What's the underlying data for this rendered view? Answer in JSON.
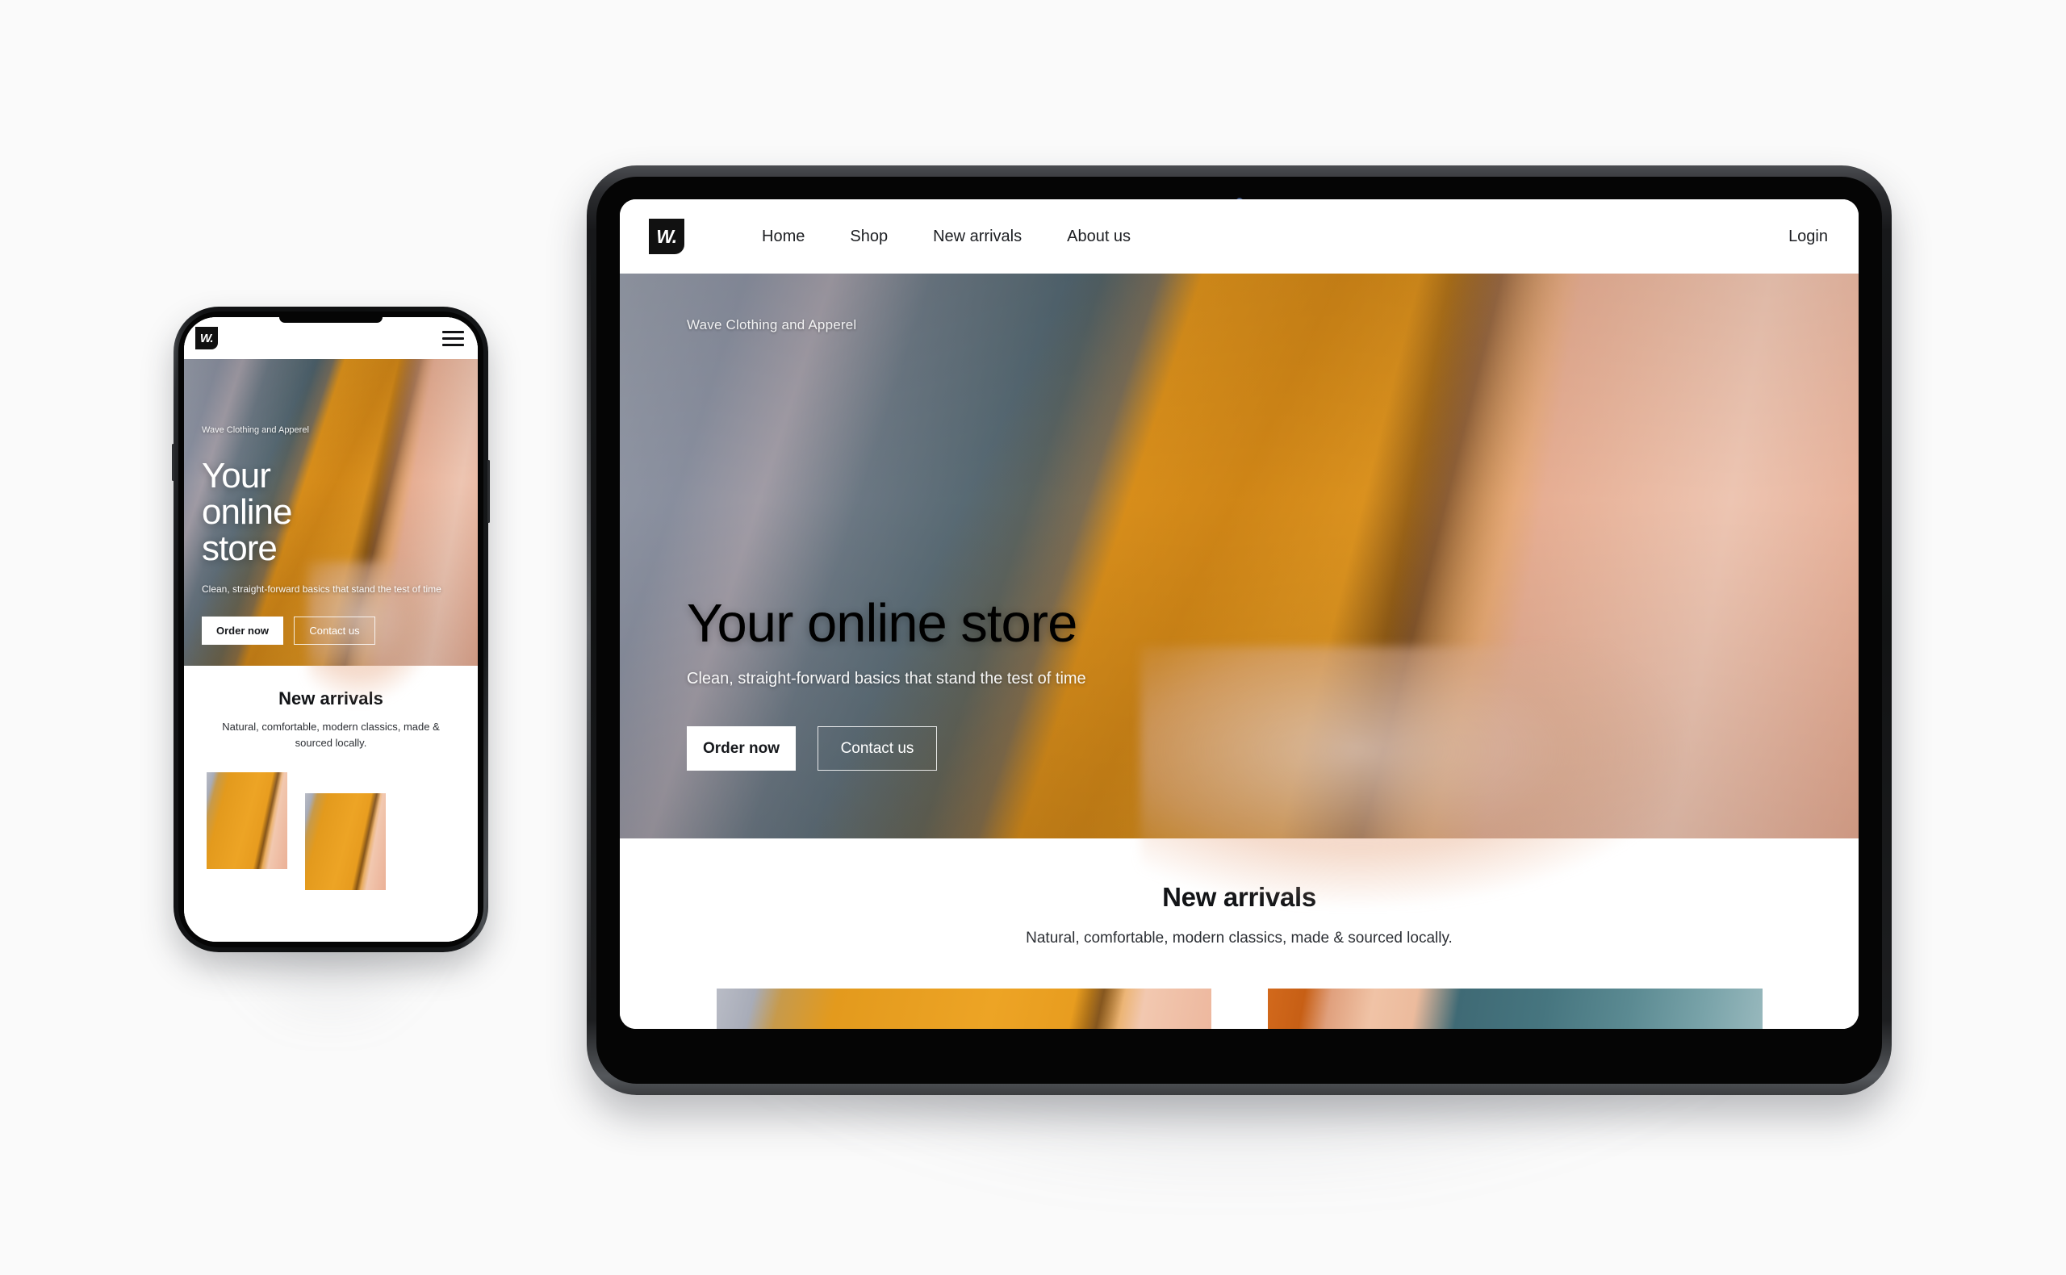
{
  "page": {
    "background_color": "#fafafa",
    "devices": [
      "tablet",
      "phone"
    ]
  },
  "brand": {
    "logo_text": "W.",
    "logo_bg": "#111111",
    "logo_fg": "#ffffff"
  },
  "site": {
    "nav": {
      "links": [
        {
          "label": "Home"
        },
        {
          "label": "Shop"
        },
        {
          "label": "New arrivals"
        },
        {
          "label": "About us"
        }
      ],
      "login_label": "Login",
      "menu_icon": "hamburger-menu-icon"
    },
    "hero": {
      "eyebrow": "Wave Clothing and Apperel",
      "heading": "Your online store",
      "heading_mobile_lines": [
        "Your",
        "online",
        "store"
      ],
      "subheading": "Clean, straight-forward basics that stand the test of time",
      "primary_button": "Order now",
      "secondary_button": "Contact us"
    },
    "arrivals": {
      "title": "New arrivals",
      "description": "Natural, comfortable, modern classics, made & sourced locally.",
      "cards": [
        {
          "alt": "amber-shirt-product-photo"
        },
        {
          "alt": "teal-denim-product-photo"
        }
      ]
    }
  },
  "colors": {
    "accent_amber": "#eda425",
    "accent_denim": "#5d6f79",
    "text_dark": "#121417",
    "surface": "#ffffff"
  }
}
